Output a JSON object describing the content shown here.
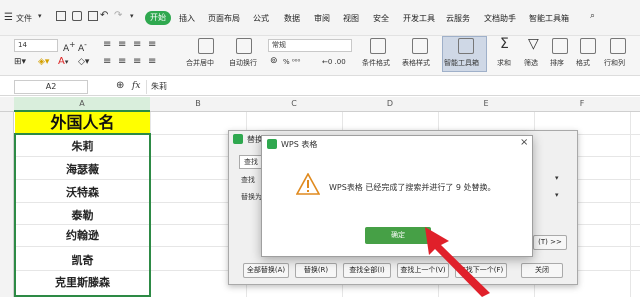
{
  "menubar": {
    "file_label": "文件",
    "tabs": [
      "开始",
      "插入",
      "页面布局",
      "公式",
      "数据",
      "审阅",
      "视图",
      "安全",
      "开发工具",
      "云服务",
      "文档助手",
      "智能工具箱"
    ]
  },
  "ribbon": {
    "font_size": "14",
    "number_format": "常规",
    "merge_center": "合并居中",
    "wrap_text": "自动换行",
    "conditional_format": "条件格式",
    "table_style": "表格样式",
    "smart_toolbox": "智能工具箱",
    "sum": "求和",
    "filter": "筛选",
    "sort": "排序",
    "format": "格式",
    "row_col": "行和列",
    "percent_symbols": "% ⁰⁰⁰"
  },
  "formula_bar": {
    "cell_ref": "A2",
    "fx_label": "fx",
    "content": "朱莉"
  },
  "columns": [
    "A",
    "B",
    "C",
    "D",
    "E",
    "F"
  ],
  "sheet": {
    "header": "外国人名",
    "names": [
      "朱莉",
      "海瑟薇",
      "沃特森",
      "泰勒",
      "约翰逊",
      "凯奇",
      "克里斯滕森"
    ]
  },
  "replace_dialog": {
    "title": "替换",
    "tab_find": "查找",
    "find_label": "查找",
    "replace_label": "替换为",
    "options_button": "(T) >>",
    "buttons": [
      "全部替换(A)",
      "替换(R)",
      "查找全部(I)",
      "查找上一个(V)",
      "查找下一个(F)",
      "关闭"
    ]
  },
  "alert": {
    "title": "WPS 表格",
    "message": "WPS表格 已经完成了搜索并进行了 9 处替换。",
    "ok": "确定"
  },
  "colors": {
    "accent": "#2fa84f",
    "header_fill": "#ffff00",
    "arrow": "#e0202a"
  }
}
